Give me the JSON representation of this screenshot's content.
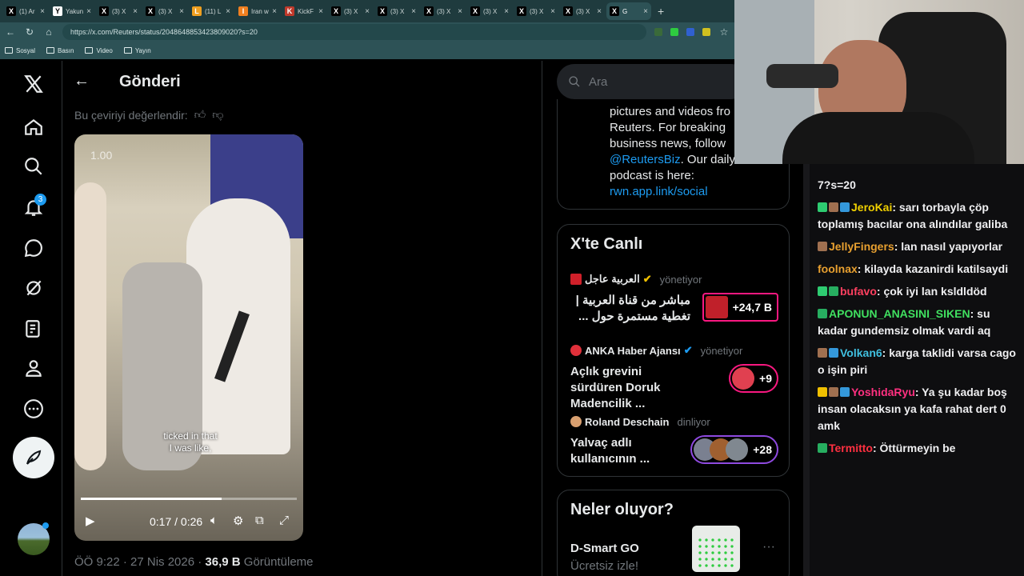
{
  "browser": {
    "tabs": [
      {
        "label": "(1) Ar",
        "color": "#000000",
        "glyph": "X"
      },
      {
        "label": "Yakun",
        "color": "#ffffff",
        "glyph": "Y"
      },
      {
        "label": "(3) X",
        "color": "#000000",
        "glyph": "X"
      },
      {
        "label": "(3) X",
        "color": "#000000",
        "glyph": "X"
      },
      {
        "label": "(11) L",
        "color": "#f0a020",
        "glyph": "L"
      },
      {
        "label": "Iran w",
        "color": "#f08020",
        "glyph": "I"
      },
      {
        "label": "KickF",
        "color": "#c0392b",
        "glyph": "K"
      },
      {
        "label": "(3) X",
        "color": "#000000",
        "glyph": "X"
      },
      {
        "label": "(3) X",
        "color": "#000000",
        "glyph": "X"
      },
      {
        "label": "(3) X",
        "color": "#000000",
        "glyph": "X"
      },
      {
        "label": "(3) X",
        "color": "#000000",
        "glyph": "X"
      },
      {
        "label": "(3) X",
        "color": "#000000",
        "glyph": "X"
      },
      {
        "label": "(3) X",
        "color": "#000000",
        "glyph": "X"
      },
      {
        "label": "G",
        "color": "#000000",
        "glyph": "X"
      }
    ],
    "url": "https://x.com/Reuters/status/2048648853423809020?s=20",
    "bookmarks": [
      "Sosyal",
      "Basın",
      "Video",
      "Yayın"
    ]
  },
  "header": {
    "title": "Gönderi"
  },
  "translation_rate": "Bu çeviriyi değerlendir:",
  "notification_count": "3",
  "video": {
    "speed": "1.00",
    "caption_line1": "ticked in that",
    "caption_line2": "I was like,",
    "time": "0:17 / 0:26",
    "progress": 0.65
  },
  "post_meta": {
    "time": "ÖÖ 9:22 · 27 Nis 2026 · ",
    "views": "36,9 B",
    "views_label": " Görüntüleme"
  },
  "search": {
    "placeholder": "Ara"
  },
  "bio": {
    "line1": "pictures and videos fro",
    "line2": "Reuters. For breaking",
    "line3": "business news, follow",
    "handle": "@ReutersBiz",
    "line4": ". Our daily",
    "line5": "podcast is here:",
    "link": "rwn.app.link/social"
  },
  "live": {
    "title": "X'te Canlı",
    "items": [
      {
        "host": "العربية عاجل",
        "role": "yönetiyor",
        "title": "مباشر من قناة العربية | تغطية مستمرة حول ...",
        "count": "+24,7 B"
      },
      {
        "host": "ANKA Haber Ajansı",
        "role": "yönetiyor",
        "title": "Açlık grevini sürdüren Doruk Madencilik ...",
        "count": "+9"
      },
      {
        "host": "Roland Deschain",
        "role": "dinliyor",
        "title": "Yalvaç adlı kullanıcının ...",
        "count": "+28"
      }
    ]
  },
  "trends": {
    "title": "Neler oluyor?",
    "name": "D-Smart GO",
    "sub": "Ücretsiz izle!"
  },
  "chat": [
    {
      "user": "",
      "text": "7?s=20",
      "color": "#efeff1",
      "badges": []
    },
    {
      "user": "JeroKai",
      "text": " sarı torbayla çöp toplamış bacılar ona alındılar galiba",
      "color": "#f0d000",
      "badges": [
        "#2ecc71",
        "#a07050",
        "#3498db"
      ]
    },
    {
      "user": "JellyFingers",
      "text": " lan nasıl yapıyorlar",
      "color": "#e8a030",
      "badges": [
        "#a07050"
      ]
    },
    {
      "user": "foolnax",
      "text": " kilayda kazanirdi katilsaydi",
      "color": "#e8a030",
      "badges": []
    },
    {
      "user": "bufavo",
      "text": " çok iyi lan ksldldöd",
      "color": "#ff4060",
      "badges": [
        "#2ecc71",
        "#27ae60"
      ]
    },
    {
      "user": "APONUN_ANASINI_SIKEN",
      "text": " su kadar gundemsiz olmak vardi aq",
      "color": "#40e060",
      "badges": [
        "#27ae60"
      ]
    },
    {
      "user": "Volkan6",
      "text": " karga taklidi varsa cago o işin piri",
      "color": "#40c0e0",
      "badges": [
        "#a07050",
        "#3498db"
      ]
    },
    {
      "user": "YoshidaRyu",
      "text": " Ya şu kadar boş insan olacaksın ya kafa rahat dert 0 amk",
      "color": "#ff3080",
      "badges": [
        "#f0c000",
        "#a07050",
        "#3498db"
      ]
    },
    {
      "user": "Termitto",
      "text": " Öttürmeyin be",
      "color": "#ff3040",
      "badges": [
        "#27ae60"
      ]
    }
  ]
}
